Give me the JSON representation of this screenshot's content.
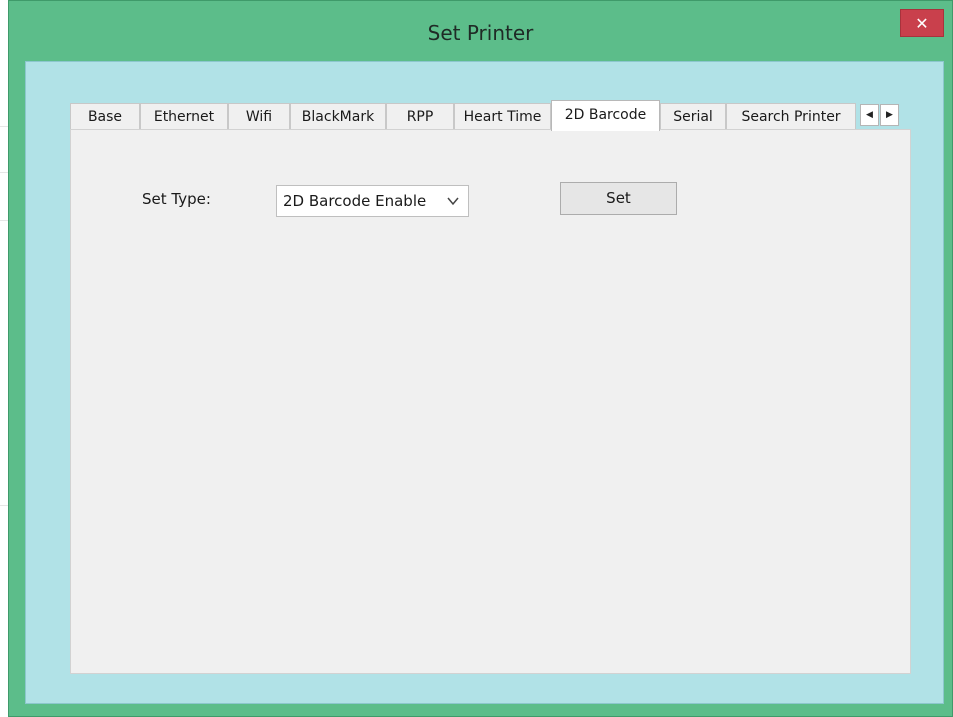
{
  "window": {
    "title": "Set Printer",
    "close_glyph": "✕"
  },
  "tabs": [
    {
      "label": "Base"
    },
    {
      "label": "Ethernet"
    },
    {
      "label": "Wifi"
    },
    {
      "label": "BlackMark"
    },
    {
      "label": "RPP"
    },
    {
      "label": "Heart Time"
    },
    {
      "label": "2D Barcode",
      "active": true
    },
    {
      "label": "Serial"
    },
    {
      "label": "Search Printer"
    }
  ],
  "tab_scroll": {
    "left_glyph": "◀",
    "right_glyph": "▶"
  },
  "form": {
    "set_type_label": "Set Type:",
    "set_type_value": "2D Barcode Enable",
    "set_button_label": "Set"
  },
  "colors": {
    "titlebar": "#5cbd8a",
    "client": "#b1e2e7",
    "panel": "#f0f0f0",
    "close": "#c9404c"
  }
}
